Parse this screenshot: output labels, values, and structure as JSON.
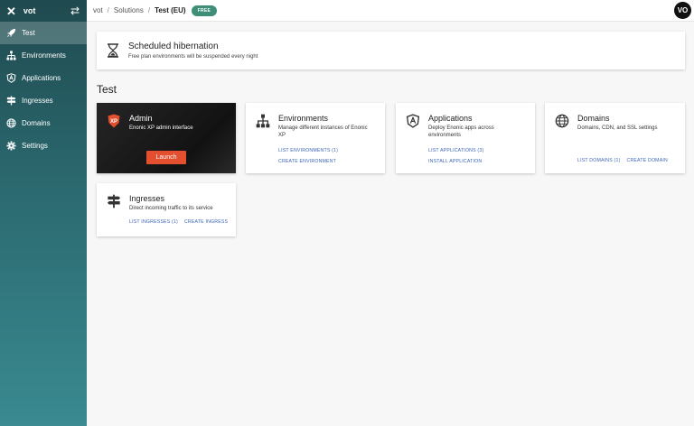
{
  "sidebar": {
    "project": "vot",
    "items": [
      {
        "label": "Test",
        "icon": "rocket-icon",
        "active": true
      },
      {
        "label": "Environments",
        "icon": "sitemap-icon"
      },
      {
        "label": "Applications",
        "icon": "app-shield-icon"
      },
      {
        "label": "Ingresses",
        "icon": "signpost-icon"
      },
      {
        "label": "Domains",
        "icon": "globe-icon"
      },
      {
        "label": "Settings",
        "icon": "gear-icon"
      }
    ]
  },
  "header": {
    "breadcrumb": [
      "vot",
      "Solutions",
      "Test (EU)"
    ],
    "badge": "FREE",
    "avatar": "VO"
  },
  "banner": {
    "title": "Scheduled hibernation",
    "subtitle": "Free plan environments will be suspended every night"
  },
  "section_title": "Test",
  "cards": {
    "admin": {
      "title": "Admin",
      "desc": "Enonic XP admin interface",
      "button": "Launch",
      "icon_text": "XP"
    },
    "environments": {
      "title": "Environments",
      "desc": "Manage different instances of Enonic XP",
      "links": [
        "LIST ENVIRONMENTS (1)",
        "CREATE ENVIRONMENT"
      ]
    },
    "applications": {
      "title": "Applications",
      "desc": "Deploy Enonic apps across environments",
      "links": [
        "LIST APPLICATIONS (3)",
        "INSTALL APPLICATION"
      ]
    },
    "domains": {
      "title": "Domains",
      "desc": "Domains, CDN, and SSL settings",
      "links": [
        "LIST DOMAINS (1)",
        "CREATE DOMAIN"
      ]
    },
    "ingresses": {
      "title": "Ingresses",
      "desc": "Direct incoming traffic to its service",
      "links": [
        "LIST INGRESSES (1)",
        "CREATE INGRESS"
      ]
    }
  },
  "colors": {
    "accent": "#3f8f78",
    "link": "#3b65b8",
    "launch": "#e4502f",
    "xp_badge": "#e4502f"
  }
}
